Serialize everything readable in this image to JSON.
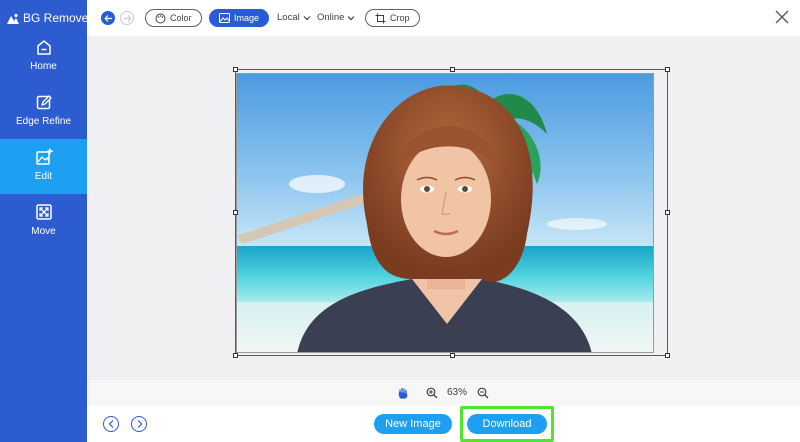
{
  "app": {
    "title": "BG Remover"
  },
  "sidebar": {
    "items": [
      {
        "label": "Home",
        "icon": "home-icon",
        "active": false
      },
      {
        "label": "Edge Refine",
        "icon": "edge-refine-icon",
        "active": false
      },
      {
        "label": "Edit",
        "icon": "edit-image-icon",
        "active": true
      },
      {
        "label": "Move",
        "icon": "move-icon",
        "active": false
      }
    ]
  },
  "toolbar": {
    "color_label": "Color",
    "image_label": "Image",
    "local_label": "Local",
    "online_label": "Online",
    "crop_label": "Crop"
  },
  "zoom": {
    "level": "63%"
  },
  "bottom": {
    "new_image_label": "New Image",
    "download_label": "Download"
  },
  "colors": {
    "sidebar_bg": "#2d5bd0",
    "sidebar_active": "#1ea0f2",
    "accent": "#2a5bd7",
    "button_blue": "#1ea0f2",
    "highlight_green": "#4ee82a"
  }
}
